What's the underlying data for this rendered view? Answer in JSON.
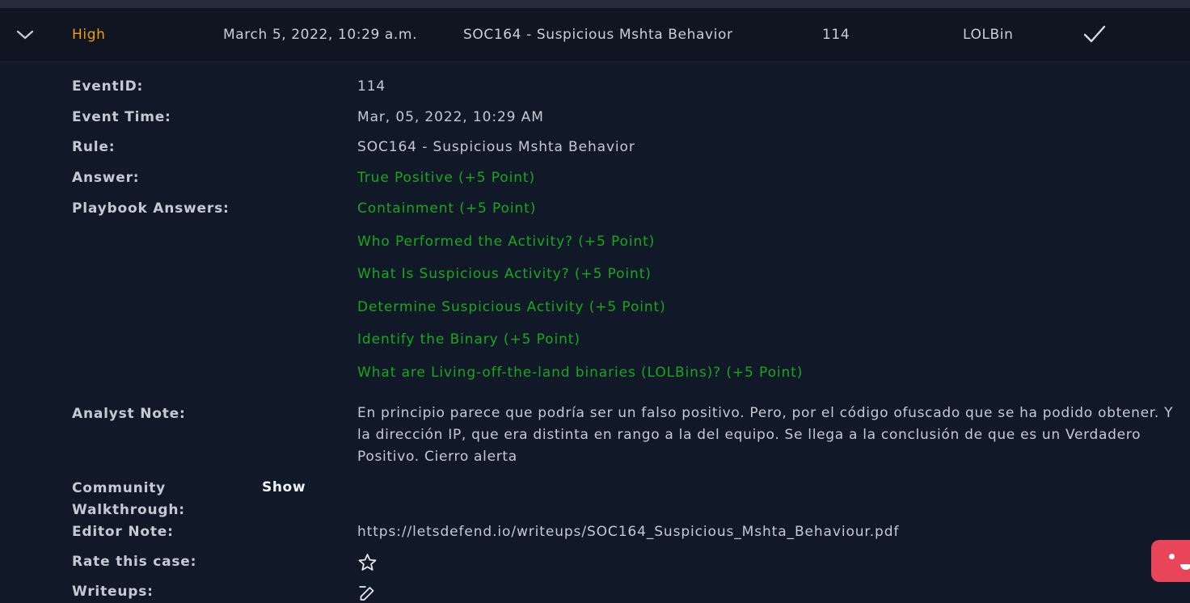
{
  "alert_row": {
    "severity": "High",
    "date": "March 5, 2022, 10:29 a.m.",
    "rule": "SOC164 - Suspicious Mshta Behavior",
    "event_id": "114",
    "type": "LOLBin",
    "expand_icon": "chevron-down-icon",
    "status_icon": "check-icon"
  },
  "details": {
    "event_id_label": "EventID:",
    "event_id_value": "114",
    "event_time_label": "Event Time:",
    "event_time_value": "Mar, 05, 2022, 10:29 AM",
    "rule_label": "Rule:",
    "rule_value": "SOC164 - Suspicious Mshta Behavior",
    "answer_label": "Answer:",
    "answer_value": "True Positive (+5 Point)",
    "playbook_label": "Playbook Answers:",
    "playbook_answers": [
      "Containment (+5 Point)",
      "Who Performed the Activity? (+5 Point)",
      "What Is Suspicious Activity? (+5 Point)",
      "Determine Suspicious Activity (+5 Point)",
      "Identify the Binary (+5 Point)",
      "What are Living-off-the-land binaries (LOLBins)? (+5 Point)"
    ],
    "analyst_note_label": "Analyst Note:",
    "analyst_note_value": "En principio parece que podría ser un falso positivo. Pero, por el código ofuscado que se ha podido obtener. Y la dirección IP, que era distinta en rango a la del equipo. Se llega a la conclusión de que es un Verdadero Positivo. Cierro alerta",
    "community_label_line1": "Community",
    "community_label_line2": "Walkthrough:",
    "community_show": "Show",
    "editor_note_label": "Editor Note:",
    "editor_note_value": "https://letsdefend.io/writeups/SOC164_Suspicious_Mshta_Behaviour.pdf",
    "rate_label": "Rate this case:",
    "rate_icon": "star-icon",
    "writeups_label": "Writeups:",
    "writeups_icon": "edit-icon"
  },
  "colors": {
    "background": "#111827",
    "severity_high": "#f59e0b",
    "correct_answer": "#17a81c",
    "chat_widget": "#e8455b"
  }
}
